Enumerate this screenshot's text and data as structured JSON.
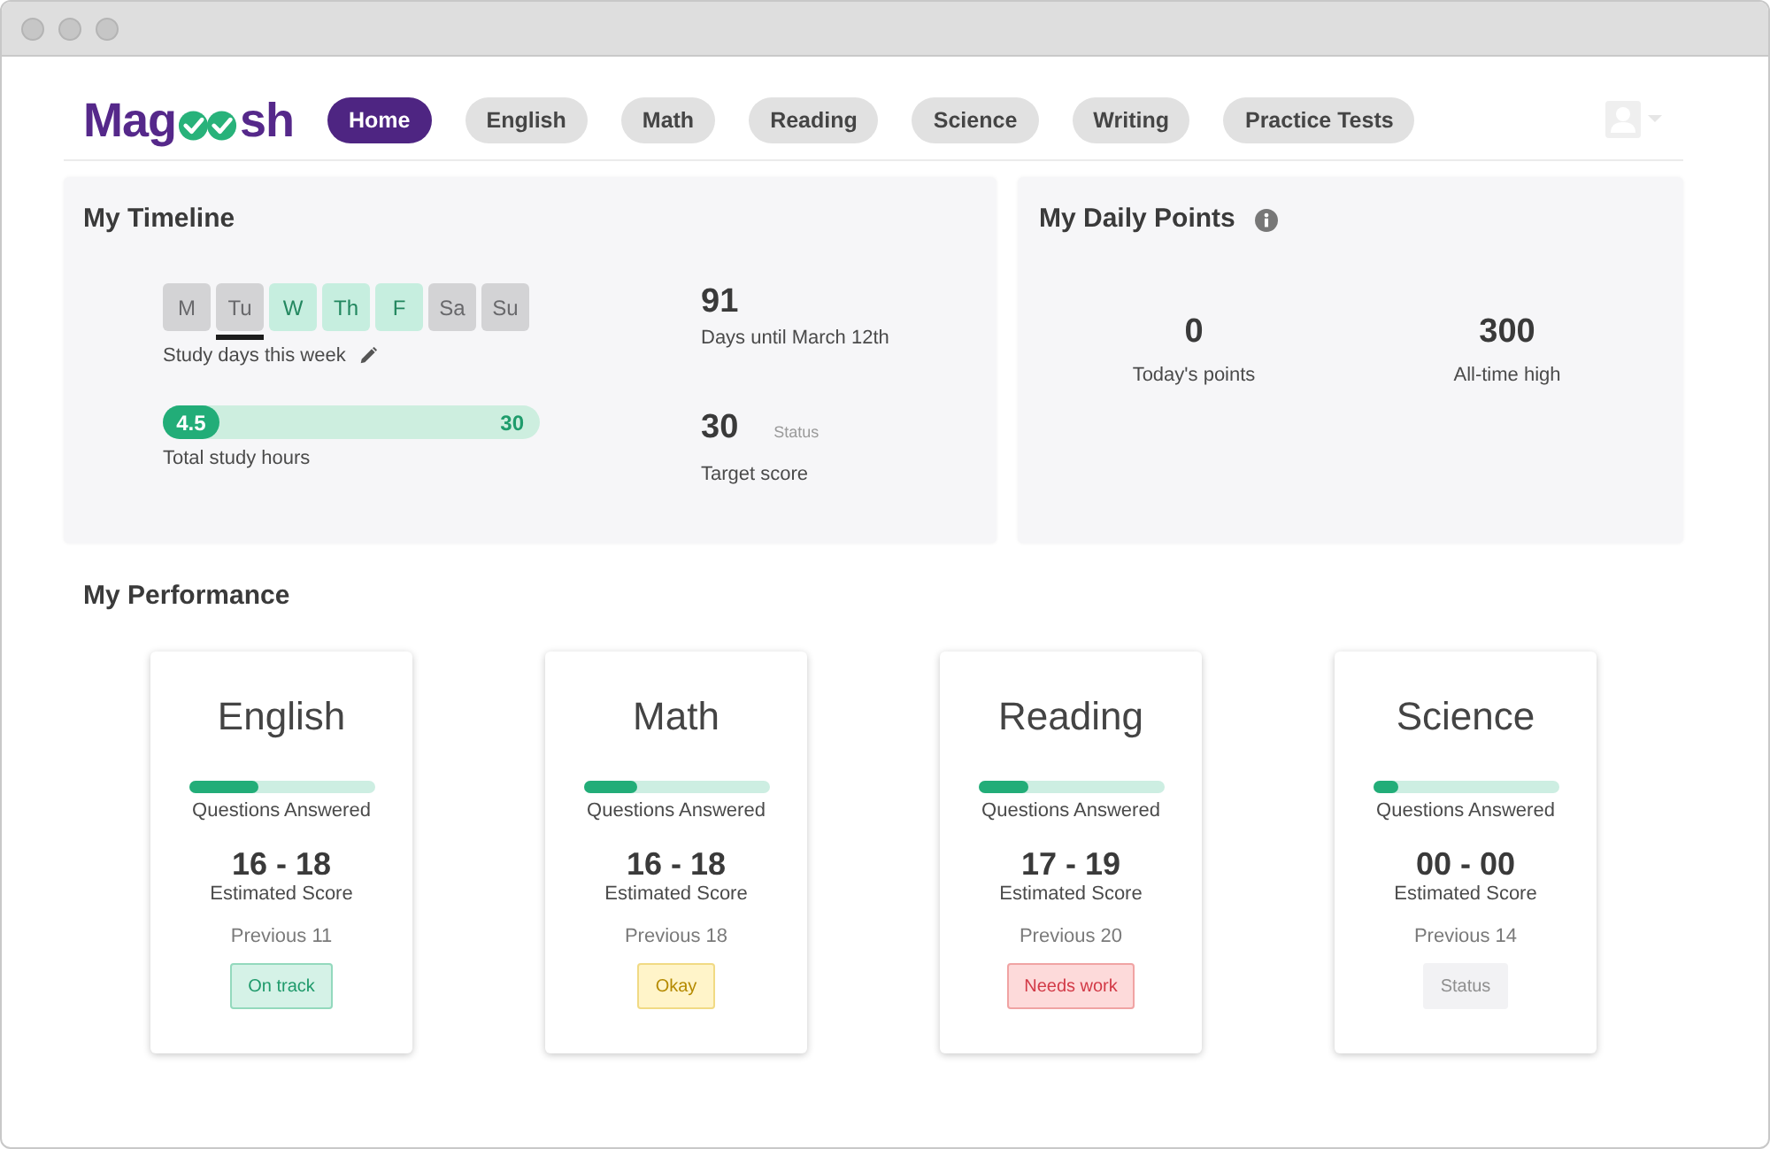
{
  "logo": {
    "text_start": "Mag",
    "text_end": "sh"
  },
  "nav": {
    "tabs": [
      {
        "label": "Home",
        "selected": true
      },
      {
        "label": "English",
        "selected": false
      },
      {
        "label": "Math",
        "selected": false
      },
      {
        "label": "Reading",
        "selected": false
      },
      {
        "label": "Science",
        "selected": false
      },
      {
        "label": "Writing",
        "selected": false
      },
      {
        "label": "Practice Tests",
        "selected": false
      }
    ]
  },
  "timeline": {
    "title": "My Timeline",
    "days": [
      {
        "label": "M",
        "study": false,
        "current": false
      },
      {
        "label": "Tu",
        "study": false,
        "current": true
      },
      {
        "label": "W",
        "study": true,
        "current": false
      },
      {
        "label": "Th",
        "study": true,
        "current": false
      },
      {
        "label": "F",
        "study": true,
        "current": false
      },
      {
        "label": "Sa",
        "study": false,
        "current": false
      },
      {
        "label": "Su",
        "study": false,
        "current": false
      }
    ],
    "days_caption": "Study days this week",
    "hours": {
      "value": "4.5",
      "total": "30",
      "level": 0.15,
      "caption": "Total study hours"
    },
    "countdown": {
      "value": "91",
      "caption": "Days until March 12th"
    },
    "target": {
      "value": "30",
      "status": "Status",
      "caption": "Target score"
    }
  },
  "daily_points": {
    "title": "My Daily Points",
    "stats": [
      {
        "value": "0",
        "caption": "Today's points"
      },
      {
        "value": "300",
        "caption": "All-time high"
      }
    ]
  },
  "performance": {
    "title": "My Performance",
    "subjects": [
      {
        "name": "English",
        "level": 0.38,
        "progress_caption": "Questions Answered",
        "score": "16 - 18",
        "score_caption": "Estimated Score",
        "previous": "Previous 11",
        "status": {
          "label": "On track",
          "kind": "good"
        }
      },
      {
        "name": "Math",
        "level": 0.29,
        "progress_caption": "Questions Answered",
        "score": "16 - 18",
        "score_caption": "Estimated Score",
        "previous": "Previous 18",
        "status": {
          "label": "Okay",
          "kind": "okay"
        }
      },
      {
        "name": "Reading",
        "level": 0.27,
        "progress_caption": "Questions Answered",
        "score": "17 - 19",
        "score_caption": "Estimated Score",
        "previous": "Previous 20",
        "status": {
          "label": "Needs work",
          "kind": "bad"
        }
      },
      {
        "name": "Science",
        "level": 0.14,
        "progress_caption": "Questions Answered",
        "score": "00 - 00",
        "score_caption": "Estimated Score",
        "previous": "Previous 14",
        "status": {
          "label": "Status",
          "kind": "none"
        }
      }
    ]
  }
}
